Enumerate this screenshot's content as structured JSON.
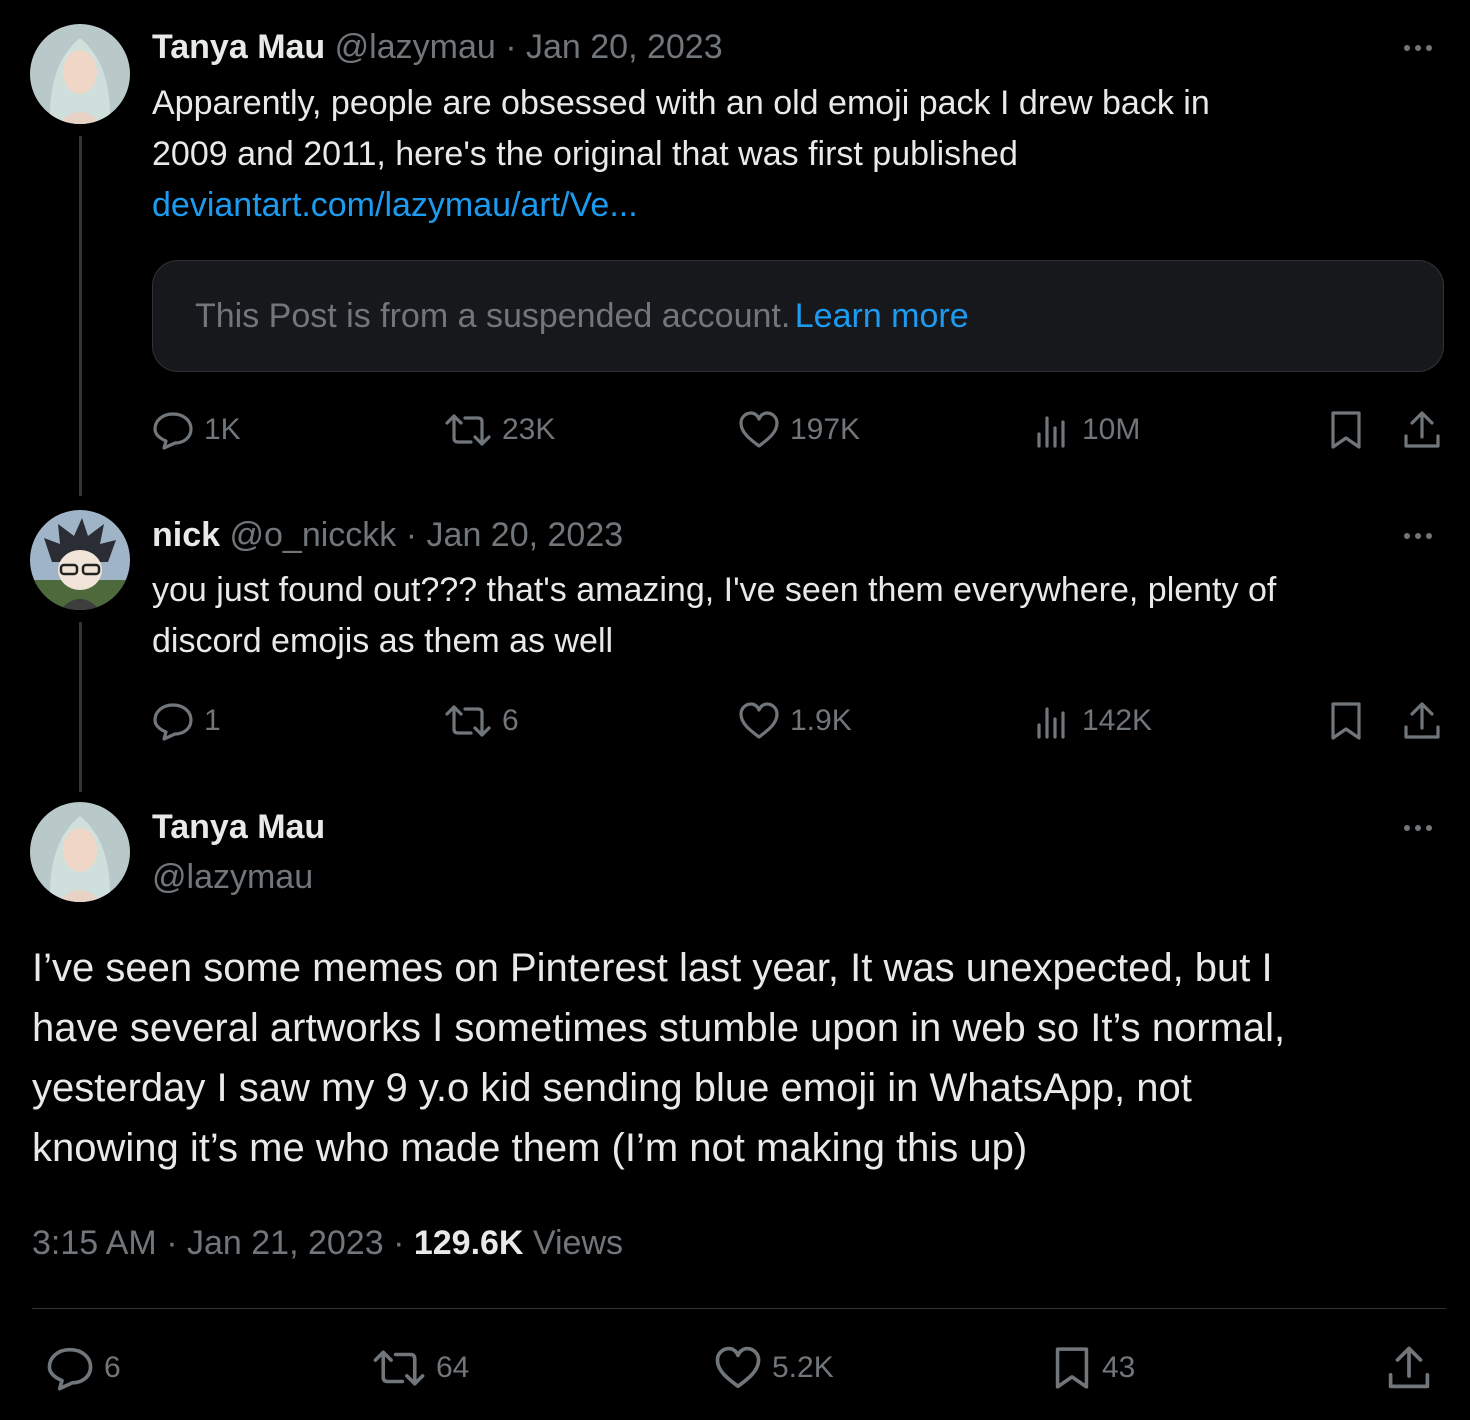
{
  "post1": {
    "name": "Tanya Mau",
    "handle": "@lazymau",
    "sep": "·",
    "date": "Jan 20, 2023",
    "line1": "Apparently, people are obsessed with an old emoji pack I drew back in",
    "line2": "2009 and 2011, here's the original that was first published",
    "link": "deviantart.com/lazymau/art/Ve...",
    "notice_text": "This Post is from a suspended account.",
    "notice_link": "Learn more",
    "replies": "1K",
    "reposts": "23K",
    "likes": "197K",
    "views": "10M"
  },
  "post2": {
    "name": "nick",
    "handle": "@o_nicckk",
    "sep": "·",
    "date": "Jan 20, 2023",
    "line1": "you just found out??? that's amazing, I've seen them everywhere, plenty of",
    "line2": "discord emojis as them as well",
    "replies": "1",
    "reposts": "6",
    "likes": "1.9K",
    "views": "142K"
  },
  "main": {
    "name": "Tanya Mau",
    "handle": "@lazymau",
    "line1": "I’ve seen some memes on Pinterest last year, It was unexpected, but I",
    "line2": "have several artworks I sometimes stumble upon in web so It’s normal,",
    "line3": "yesterday I saw my 9 y.o kid sending blue emoji in WhatsApp, not",
    "line4": "knowing it’s me who made them (I’m not making this up)",
    "time": "3:15 AM",
    "sep1": "·",
    "date": "Jan 21, 2023",
    "sep2": "·",
    "views_count": "129.6K",
    "views_label": "Views",
    "replies": "6",
    "reposts": "64",
    "likes": "5.2K",
    "bookmarks": "43"
  },
  "colors": {
    "background": "#000000",
    "text": "#e7e9ea",
    "muted": "#71767b",
    "link": "#1d9bf0",
    "border": "#2f3336"
  },
  "icons": [
    "more-icon",
    "reply-icon",
    "repost-icon",
    "like-icon",
    "views-icon",
    "bookmark-icon",
    "share-icon"
  ]
}
